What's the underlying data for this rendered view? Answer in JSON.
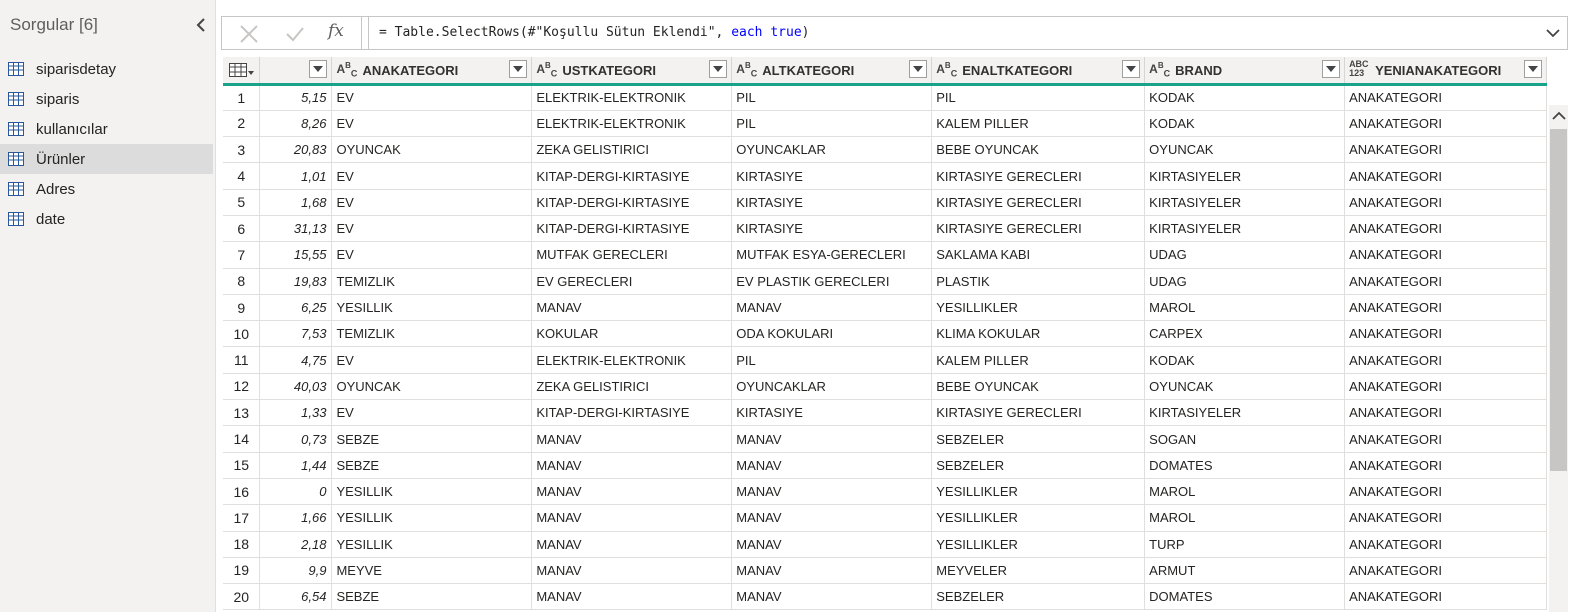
{
  "queries": {
    "header": "Sorgular [6]",
    "items": [
      {
        "label": "siparisdetay",
        "selected": false
      },
      {
        "label": "siparis",
        "selected": false
      },
      {
        "label": "kullanıcılar",
        "selected": false
      },
      {
        "label": "Ürünler",
        "selected": true
      },
      {
        "label": "Adres",
        "selected": false
      },
      {
        "label": "date",
        "selected": false
      }
    ]
  },
  "formula_bar": {
    "fx_label": "fx",
    "prefix": "= Table.SelectRows(#\"Koşullu Sütun Eklendi\", ",
    "keyword_each": "each",
    "space": " ",
    "keyword_true": "true",
    "suffix": ")"
  },
  "table": {
    "columns": [
      {
        "name": "",
        "type": "1.2"
      },
      {
        "name": "ANAKATEGORI",
        "type": "text"
      },
      {
        "name": "USTKATEGORI",
        "type": "text"
      },
      {
        "name": "ALTKATEGORI",
        "type": "text"
      },
      {
        "name": "ENALTKATEGORI",
        "type": "text"
      },
      {
        "name": "BRAND",
        "type": "text"
      },
      {
        "name": "YENIANAKATEGORI",
        "type": "any"
      }
    ],
    "type_any_top": "ABC",
    "type_any_bottom": "123",
    "rows": [
      [
        "1",
        "5,15",
        "EV",
        "ELEKTRIK-ELEKTRONIK",
        "PIL",
        "PIL",
        "KODAK",
        "ANAKATEGORI"
      ],
      [
        "2",
        "8,26",
        "EV",
        "ELEKTRIK-ELEKTRONIK",
        "PIL",
        "KALEM PILLER",
        "KODAK",
        "ANAKATEGORI"
      ],
      [
        "3",
        "20,83",
        "OYUNCAK",
        "ZEKA GELISTIRICI",
        "OYUNCAKLAR",
        "BEBE OYUNCAK",
        "OYUNCAK",
        "ANAKATEGORI"
      ],
      [
        "4",
        "1,01",
        "EV",
        "KITAP-DERGI-KIRTASIYE",
        "KIRTASIYE",
        "KIRTASIYE GERECLERI",
        "KIRTASIYELER",
        "ANAKATEGORI"
      ],
      [
        "5",
        "1,68",
        "EV",
        "KITAP-DERGI-KIRTASIYE",
        "KIRTASIYE",
        "KIRTASIYE GERECLERI",
        "KIRTASIYELER",
        "ANAKATEGORI"
      ],
      [
        "6",
        "31,13",
        "EV",
        "KITAP-DERGI-KIRTASIYE",
        "KIRTASIYE",
        "KIRTASIYE GERECLERI",
        "KIRTASIYELER",
        "ANAKATEGORI"
      ],
      [
        "7",
        "15,55",
        "EV",
        "MUTFAK GERECLERI",
        "MUTFAK ESYA-GERECLERI",
        "SAKLAMA KABI",
        "UDAG",
        "ANAKATEGORI"
      ],
      [
        "8",
        "19,83",
        "TEMIZLIK",
        "EV GERECLERI",
        "EV PLASTIK GERECLERI",
        "PLASTIK",
        "UDAG",
        "ANAKATEGORI"
      ],
      [
        "9",
        "6,25",
        "YESILLIK",
        "MANAV",
        "MANAV",
        "YESILLIKLER",
        "MAROL",
        "ANAKATEGORI"
      ],
      [
        "10",
        "7,53",
        "TEMIZLIK",
        "KOKULAR",
        "ODA KOKULARI",
        "KLIMA KOKULAR",
        "CARPEX",
        "ANAKATEGORI"
      ],
      [
        "11",
        "4,75",
        "EV",
        "ELEKTRIK-ELEKTRONIK",
        "PIL",
        "KALEM PILLER",
        "KODAK",
        "ANAKATEGORI"
      ],
      [
        "12",
        "40,03",
        "OYUNCAK",
        "ZEKA GELISTIRICI",
        "OYUNCAKLAR",
        "BEBE OYUNCAK",
        "OYUNCAK",
        "ANAKATEGORI"
      ],
      [
        "13",
        "1,33",
        "EV",
        "KITAP-DERGI-KIRTASIYE",
        "KIRTASIYE",
        "KIRTASIYE GERECLERI",
        "KIRTASIYELER",
        "ANAKATEGORI"
      ],
      [
        "14",
        "0,73",
        "SEBZE",
        "MANAV",
        "MANAV",
        "SEBZELER",
        "SOGAN",
        "ANAKATEGORI"
      ],
      [
        "15",
        "1,44",
        "SEBZE",
        "MANAV",
        "MANAV",
        "SEBZELER",
        "DOMATES",
        "ANAKATEGORI"
      ],
      [
        "16",
        "0",
        "YESILLIK",
        "MANAV",
        "MANAV",
        "YESILLIKLER",
        "MAROL",
        "ANAKATEGORI"
      ],
      [
        "17",
        "1,66",
        "YESILLIK",
        "MANAV",
        "MANAV",
        "YESILLIKLER",
        "MAROL",
        "ANAKATEGORI"
      ],
      [
        "18",
        "2,18",
        "YESILLIK",
        "MANAV",
        "MANAV",
        "YESILLIKLER",
        "TURP",
        "ANAKATEGORI"
      ],
      [
        "19",
        "9,9",
        "MEYVE",
        "MANAV",
        "MANAV",
        "MEYVELER",
        "ARMUT",
        "ANAKATEGORI"
      ],
      [
        "20",
        "6,54",
        "SEBZE",
        "MANAV",
        "MANAV",
        "SEBZELER",
        "DOMATES",
        "ANAKATEGORI"
      ]
    ]
  },
  "colors": {
    "header_underline": "#1aa38b",
    "selected_query_bg": "#dcdcdc",
    "keyword": "#0000ff"
  }
}
